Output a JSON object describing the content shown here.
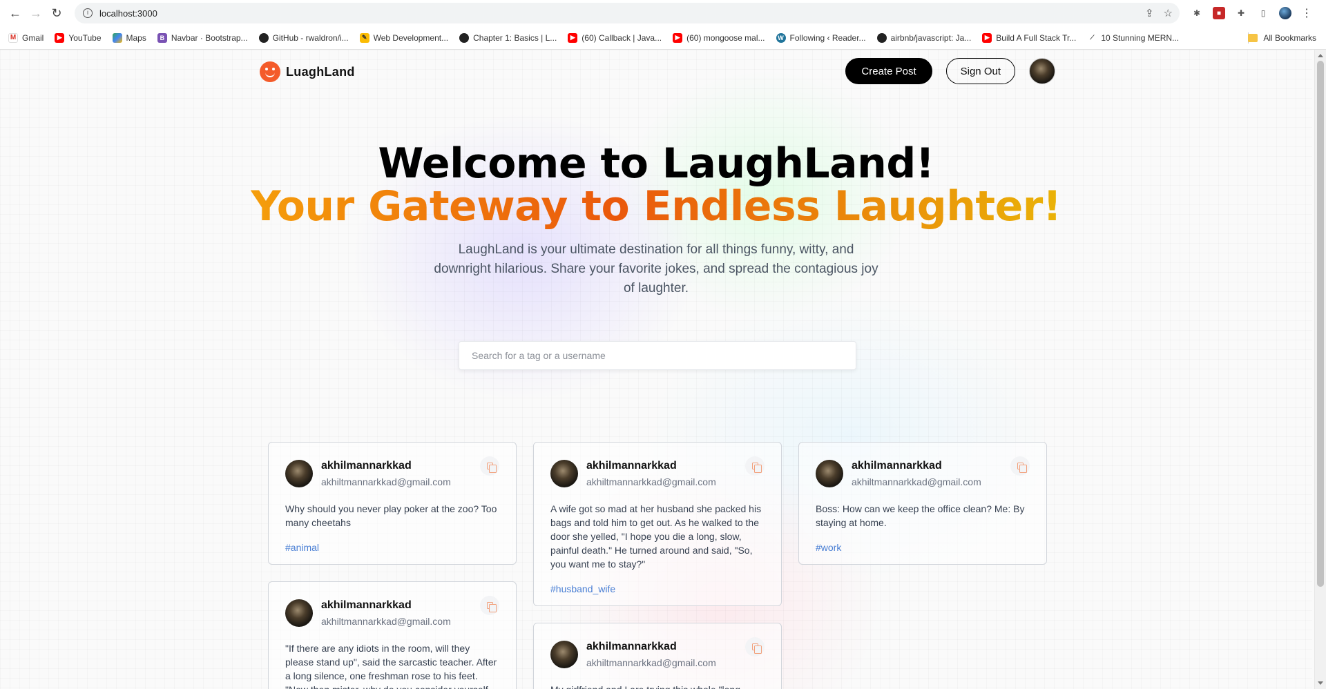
{
  "browser": {
    "url": "localhost:3000",
    "bookmarks": [
      {
        "icon": "gmail-icon",
        "glyph": "M",
        "label": "Gmail"
      },
      {
        "icon": "youtube-icon",
        "glyph": "▶",
        "label": "YouTube"
      },
      {
        "icon": "maps-icon",
        "glyph": "",
        "label": "Maps"
      },
      {
        "icon": "bootstrap-icon",
        "glyph": "B",
        "label": "Navbar · Bootstrap..."
      },
      {
        "icon": "github-icon",
        "glyph": "",
        "label": "GitHub - rwaldron/i..."
      },
      {
        "icon": "web-icon",
        "glyph": "✎",
        "label": "Web Development..."
      },
      {
        "icon": "chapter-icon",
        "glyph": "",
        "label": "Chapter 1: Basics | L..."
      },
      {
        "icon": "youtube-icon",
        "glyph": "▶",
        "label": "(60) Callback | Java..."
      },
      {
        "icon": "youtube-icon",
        "glyph": "▶",
        "label": "(60) mongoose mal..."
      },
      {
        "icon": "wordpress-icon",
        "glyph": "W",
        "label": "Following ‹ Reader..."
      },
      {
        "icon": "github-icon",
        "glyph": "",
        "label": "airbnb/javascript: Ja..."
      },
      {
        "icon": "youtube-icon",
        "glyph": "▶",
        "label": "Build A Full Stack Tr..."
      },
      {
        "icon": "mern-icon",
        "glyph": "⟋",
        "label": "10 Stunning MERN..."
      }
    ],
    "all_bookmarks": "All Bookmarks"
  },
  "site": {
    "brand": "LuaghLand",
    "create_post": "Create Post",
    "sign_out": "Sign Out"
  },
  "hero": {
    "title": "Welcome to LaughLand!",
    "subtitle": "Your Gateway to Endless Laughter!",
    "description": "LaughLand is your ultimate destination for all things funny, witty, and downright hilarious. Share your favorite jokes, and spread the contagious joy of laughter."
  },
  "search": {
    "placeholder": "Search for a tag or a username",
    "value": ""
  },
  "posts": [
    {
      "username": "akhilmannarkkad",
      "email": "akhiltmannarkkad@gmail.com",
      "text": "Why should you never play poker at the zoo? Too many cheetahs",
      "tag": "#animal"
    },
    {
      "username": "akhilmannarkkad",
      "email": "akhiltmannarkkad@gmail.com",
      "text": "A wife got so mad at her husband she packed his bags and told him to get out. As he walked to the door she yelled, \"I hope you die a long, slow, painful death.\" He turned around and said, \"So, you want me to stay?\"",
      "tag": "#husband_wife"
    },
    {
      "username": "akhilmannarkkad",
      "email": "akhiltmannarkkad@gmail.com",
      "text": "Boss: How can we keep the office clean? Me: By staying at home.",
      "tag": "#work"
    },
    {
      "username": "akhilmannarkkad",
      "email": "akhiltmannarkkad@gmail.com",
      "text": "\"If there are any idiots in the room, will they please stand up\", said the sarcastic teacher. After a long silence, one freshman rose to his feet. \"Now then mister, why do you consider yourself",
      "tag": ""
    },
    {
      "username": "akhilmannarkkad",
      "email": "akhiltmannarkkad@gmail.com",
      "text": "My girlfriend and I are trying this whole \"long",
      "tag": ""
    }
  ]
}
